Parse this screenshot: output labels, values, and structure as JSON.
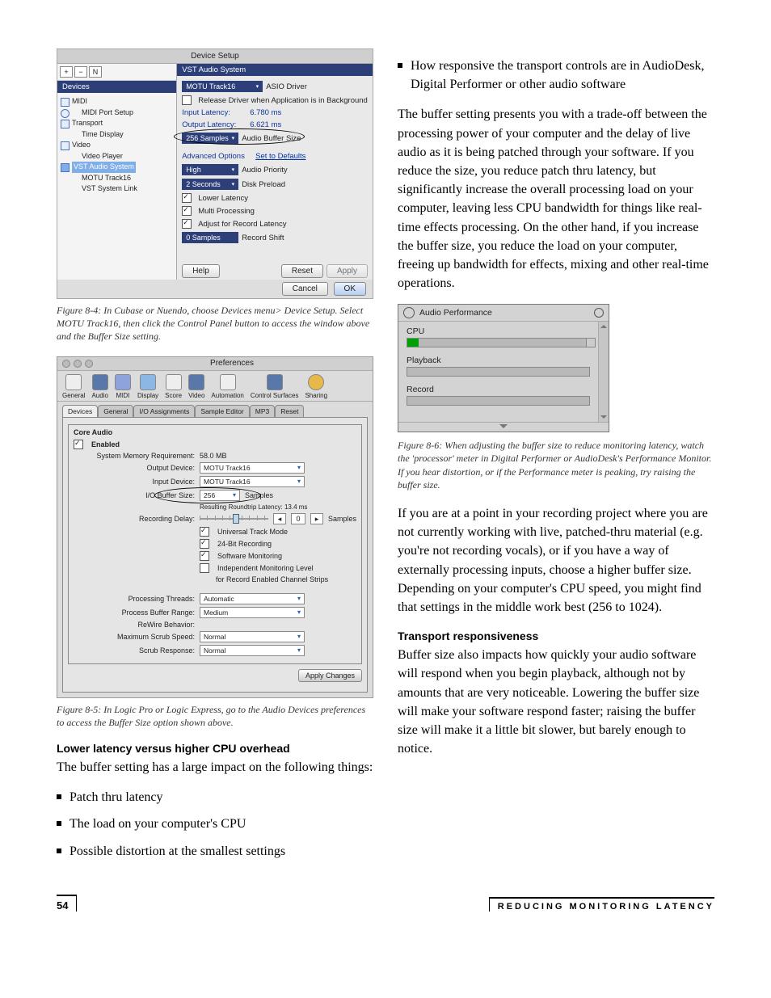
{
  "page_number": "54",
  "footer_label": "REDUCING MONITORING LATENCY",
  "fig84": {
    "title": "Device Setup",
    "toolbar": {
      "add": "+",
      "remove": "−",
      "list": "N"
    },
    "left_header": "Devices",
    "tree": {
      "midi": "MIDI",
      "midi_port": "MIDI Port Setup",
      "transport": "Transport",
      "time_display": "Time Display",
      "video": "Video",
      "video_player": "Video Player",
      "vst_audio": "VST Audio System",
      "motu": "MOTU Track16",
      "syslink": "VST System Link"
    },
    "right_header": "VST Audio System",
    "asio_driver_value": "MOTU Track16",
    "asio_driver_label": "ASIO Driver",
    "release_driver": "Release Driver when Application is in Background",
    "input_latency_label": "Input Latency:",
    "input_latency_value": "6.780 ms",
    "output_latency_label": "Output Latency:",
    "output_latency_value": "6.621 ms",
    "buffer_value": "256 Samples",
    "buffer_label": "Audio Buffer Size",
    "advanced": "Advanced Options",
    "set_defaults": "Set to Defaults",
    "priority_value": "High",
    "priority_label": "Audio Priority",
    "preload_value": "2 Seconds",
    "preload_label": "Disk Preload",
    "lower_latency": "Lower Latency",
    "multi_processing": "Multi Processing",
    "adjust_record": "Adjust for Record Latency",
    "record_shift_value": "0 Samples",
    "record_shift_label": "Record Shift",
    "help": "Help",
    "reset": "Reset",
    "apply": "Apply",
    "cancel": "Cancel",
    "ok": "OK"
  },
  "caption84": "Figure 8-4: In Cubase or Nuendo, choose Devices menu> Device Setup. Select MOTU Track16, then click the Control Panel button to access the window above and the Buffer Size setting.",
  "fig85": {
    "title": "Preferences",
    "tb": [
      "General",
      "Audio",
      "MIDI",
      "Display",
      "Score",
      "Video",
      "Automation",
      "Control Surfaces",
      "Sharing"
    ],
    "tabs": [
      "Devices",
      "General",
      "I/O Assignments",
      "Sample Editor",
      "MP3",
      "Reset"
    ],
    "core_audio": "Core Audio",
    "enabled": "Enabled",
    "sysmem_label": "System Memory Requirement:",
    "sysmem_value": "58.0 MB",
    "out_dev_label": "Output Device:",
    "out_dev_value": "MOTU Track16",
    "in_dev_label": "Input Device:",
    "in_dev_value": "MOTU Track16",
    "io_buf_label": "I/O Buffer Size:",
    "io_buf_value": "256",
    "io_buf_unit": "Samples",
    "round_label": "Resulting Roundtrip Latency:  13.4 ms",
    "rec_delay_label": "Recording Delay:",
    "rec_delay_value": "0",
    "rec_delay_unit": "Samples",
    "utm": "Universal Track Mode",
    "bit24": "24-Bit Recording",
    "swmon": "Software Monitoring",
    "indep": "Independent Monitoring Level",
    "indep2": "for Record Enabled Channel Strips",
    "pthreads_label": "Processing Threads:",
    "pthreads_value": "Automatic",
    "pbr_label": "Process Buffer Range:",
    "pbr_value": "Medium",
    "rewire_label": "ReWire Behavior:",
    "scrub_speed_label": "Maximum Scrub Speed:",
    "scrub_speed_value": "Normal",
    "scrub_resp_label": "Scrub Response:",
    "scrub_resp_value": "Normal",
    "apply": "Apply Changes"
  },
  "caption85": "Figure 8-5: In Logic Pro or Logic Express, go to the Audio Devices preferences to access the Buffer Size option shown above.",
  "head_lower_latency": "Lower latency versus higher CPU overhead",
  "para_lower_latency": "The buffer setting has a large impact on the following things:",
  "bullets_left": [
    "Patch thru latency",
    "The load on your computer's CPU",
    "Possible distortion at the smallest settings"
  ],
  "bullets_right": [
    "How responsive the transport controls are in AudioDesk, Digital Performer or other audio software"
  ],
  "para_tradeoff": "The buffer setting presents you with a trade-off between the processing power of your computer and the delay of live audio as it is being patched through your software. If you reduce the size, you reduce patch thru latency, but significantly increase the overall processing load on your computer, leaving less CPU bandwidth for things like real-time effects processing. On the other hand, if you increase the buffer size, you reduce the load on your computer, freeing up bandwidth for effects, mixing and other real-time operations.",
  "fig86": {
    "title": "Audio Performance",
    "cpu": "CPU",
    "playback": "Playback",
    "record": "Record"
  },
  "caption86": "Figure 8-6: When adjusting the buffer size to reduce monitoring latency, watch the 'processor' meter in Digital Performer or AudioDesk's Performance Monitor. If you hear distortion, or if the Performance meter is peaking, try raising the buffer size.",
  "para_point": "If you are at a point in your recording project where you are not currently working with live, patched-thru material (e.g. you're not recording vocals), or if you have a way of externally processing inputs, choose a higher buffer size. Depending on your computer's CPU speed, you might find that settings in the middle work best (256 to 1024).",
  "head_transport": "Transport responsiveness",
  "para_transport": "Buffer size also impacts how quickly your audio software will respond when you begin playback, although not by amounts that are very noticeable. Lowering the buffer size will make your software respond faster; raising the buffer size will make it a little bit slower, but barely enough to notice."
}
